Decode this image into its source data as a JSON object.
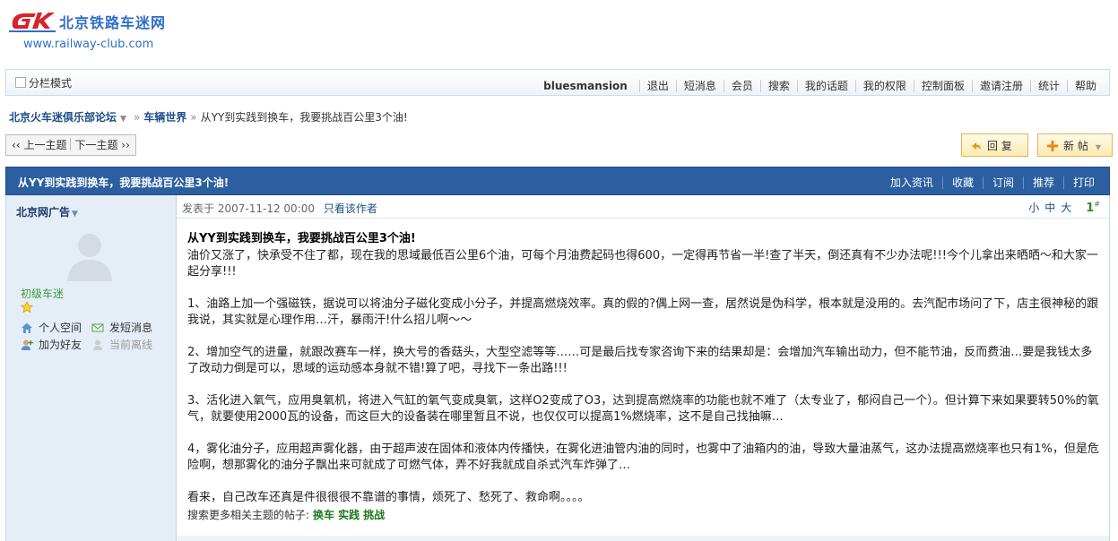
{
  "site": {
    "name_cn": "北京铁路车迷网",
    "url": "www.railway-club.com"
  },
  "topbar": {
    "split_mode": "分栏模式",
    "username": "bluesmansion",
    "links": [
      "退出",
      "短消息",
      "会员",
      "搜索",
      "我的话题",
      "我的权限",
      "控制面板",
      "邀请注册",
      "统计",
      "帮助"
    ]
  },
  "breadcrumb": {
    "forum": "北京火车迷俱乐部论坛",
    "section": "车辆世界",
    "thread": "从YY到实践到换车，我要挑战百公里3个油!"
  },
  "pager": {
    "prev": "上一主题",
    "next": "下一主题"
  },
  "actions": {
    "reply": "回 复",
    "new_post": "新 帖"
  },
  "thread_header": {
    "title": "从YY到实践到换车，我要挑战百公里3个油!",
    "tools": [
      "加入资讯",
      "收藏",
      "订阅",
      "推荐",
      "打印"
    ]
  },
  "author": {
    "name": "北京网广告",
    "rank": "初级车迷",
    "links": {
      "profile": "个人空间",
      "message": "发短消息",
      "add_friend": "加为好友",
      "status": "当前离线"
    }
  },
  "post": {
    "posted_label": "发表于",
    "posted_time": "2007-11-12 00:00",
    "author_only": "只看该作者",
    "font_small": "小",
    "font_medium": "中",
    "font_large": "大",
    "floor": "1",
    "floor_mark": "#",
    "title": "从YY到实践到换车，我要挑战百公里3个油!",
    "paragraphs": [
      "油价又涨了，快承受不住了都，现在我的思域最低百公里6个油，可每个月油费起码也得600，一定得再节省一半!查了半天，倒还真有不少办法呢!!!今个儿拿出来晒晒～和大家一起分享!!!",
      "1、油路上加一个强磁铁，据说可以将油分子磁化变成小分子，并提高燃烧效率。真的假的?偶上网一查，居然说是伪科学，根本就是没用的。去汽配市场问了下，店主很神秘的跟我说，其实就是心理作用…汗，暴雨汗!什么招儿啊～～",
      "2、增加空气的进量，就跟改赛车一样，换大号的香菇头，大型空滤等等……可是最后找专家咨询下来的结果却是：会增加汽车输出动力，但不能节油，反而费油…要是我钱太多了改动力倒是可以，思域的运动感本身就不错!算了吧，寻找下一条出路!!!",
      "3、活化进入氧气，应用臭氧机，将进入气缸的氧气变成臭氧，这样O2变成了O3，达到提高燃烧率的功能也就不难了（太专业了，郁闷自己一个）。但计算下来如果要转50%的氧气，就要使用2000瓦的设备，而这巨大的设备装在哪里暂且不说，也仅仅可以提高1%燃烧率，这不是自己找抽嘛…",
      "4，雾化油分子，应用超声雾化器，由于超声波在固体和液体内传播快，在雾化进油管内油的同时，也雾中了油箱内的油，导致大量油蒸气，这办法提高燃烧率也只有1%，但是危险啊，想那雾化的油分子飘出来可就成了可燃气体，弄不好我就成自杀式汽车炸弹了…",
      "看来，自己改车还真是件很很很不靠谱的事情，烦死了、愁死了、救命啊。。。。"
    ],
    "related_label": "搜索更多相关主题的帖子:",
    "related_tags": [
      "换车",
      "实践",
      "挑战"
    ]
  },
  "colors": {
    "brand_blue": "#2f6ec7",
    "header_blue": "#2b5fa0",
    "sidebar_bg": "#e5eef7",
    "rank_green": "#389e3c"
  }
}
